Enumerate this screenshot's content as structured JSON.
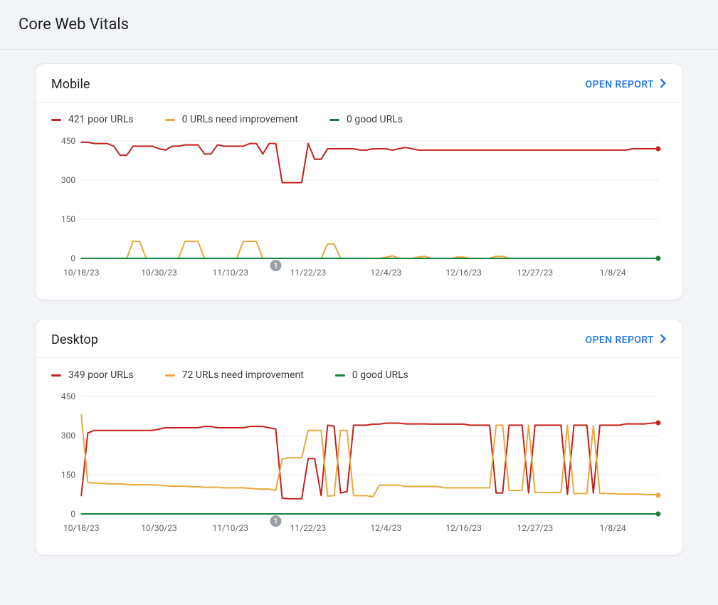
{
  "page": {
    "title": "Core Web Vitals"
  },
  "open_report_label": "OPEN REPORT",
  "colors": {
    "poor": "#c5221f",
    "need": "#e8a93e",
    "good": "#188038",
    "grid": "#e8eaed",
    "axis": "#5f6368"
  },
  "panels": [
    {
      "id": "mobile",
      "title": "Mobile",
      "legend": [
        {
          "key": "poor",
          "label": "421 poor URLs"
        },
        {
          "key": "need",
          "label": "0 URLs need improvement"
        },
        {
          "key": "good",
          "label": "0 good URLs"
        }
      ]
    },
    {
      "id": "desktop",
      "title": "Desktop",
      "legend": [
        {
          "key": "poor",
          "label": "349 poor URLs"
        },
        {
          "key": "need",
          "label": "72 URLs need improvement"
        },
        {
          "key": "good",
          "label": "0 good URLs"
        }
      ]
    }
  ],
  "chart_data": [
    {
      "id": "mobile",
      "type": "line",
      "title": "Mobile",
      "ylim": [
        0,
        450
      ],
      "yticks": [
        0,
        150,
        300,
        450
      ],
      "xticks": [
        "10/18/23",
        "10/30/23",
        "11/10/23",
        "11/22/23",
        "12/4/23",
        "12/16/23",
        "12/27/23",
        "1/8/24"
      ],
      "marker": {
        "x_index": 30,
        "label": "1"
      },
      "x_dates": [
        "10/18/23",
        "10/19/23",
        "10/20/23",
        "10/21/23",
        "10/22/23",
        "10/23/23",
        "10/24/23",
        "10/25/23",
        "10/26/23",
        "10/27/23",
        "10/28/23",
        "10/29/23",
        "10/30/23",
        "10/31/23",
        "11/1/23",
        "11/2/23",
        "11/3/23",
        "11/4/23",
        "11/5/23",
        "11/6/23",
        "11/7/23",
        "11/8/23",
        "11/9/23",
        "11/10/23",
        "11/11/23",
        "11/12/23",
        "11/13/23",
        "11/14/23",
        "11/15/23",
        "11/16/23",
        "11/17/23",
        "11/18/23",
        "11/19/23",
        "11/20/23",
        "11/21/23",
        "11/22/23",
        "11/23/23",
        "11/24/23",
        "11/25/23",
        "11/26/23",
        "11/27/23",
        "11/28/23",
        "11/29/23",
        "11/30/23",
        "12/1/23",
        "12/2/23",
        "12/3/23",
        "12/4/23",
        "12/5/23",
        "12/6/23",
        "12/7/23",
        "12/8/23",
        "12/9/23",
        "12/10/23",
        "12/11/23",
        "12/12/23",
        "12/13/23",
        "12/14/23",
        "12/15/23",
        "12/16/23",
        "12/17/23",
        "12/18/23",
        "12/19/23",
        "12/20/23",
        "12/21/23",
        "12/22/23",
        "12/23/23",
        "12/24/23",
        "12/25/23",
        "12/26/23",
        "12/27/23",
        "12/28/23",
        "12/29/23",
        "12/30/23",
        "12/31/23",
        "1/1/24",
        "1/2/24",
        "1/3/24",
        "1/4/24",
        "1/5/24",
        "1/6/24",
        "1/7/24",
        "1/8/24",
        "1/9/24",
        "1/10/24",
        "1/11/24",
        "1/12/24",
        "1/13/24",
        "1/14/24",
        "1/15/24"
      ],
      "series": [
        {
          "name": "poor",
          "values": [
            445,
            445,
            440,
            440,
            440,
            430,
            395,
            395,
            430,
            430,
            430,
            430,
            420,
            415,
            430,
            430,
            435,
            435,
            435,
            400,
            400,
            435,
            430,
            430,
            430,
            430,
            440,
            440,
            400,
            440,
            440,
            290,
            290,
            290,
            290,
            440,
            380,
            380,
            420,
            420,
            420,
            420,
            420,
            415,
            415,
            420,
            420,
            420,
            415,
            420,
            425,
            420,
            415,
            415,
            415,
            415,
            415,
            415,
            415,
            415,
            415,
            415,
            415,
            415,
            415,
            415,
            415,
            415,
            415,
            415,
            415,
            415,
            415,
            415,
            415,
            415,
            415,
            415,
            415,
            415,
            415,
            415,
            415,
            415,
            415,
            420,
            420,
            420,
            420,
            420
          ]
        },
        {
          "name": "need",
          "values": [
            0,
            0,
            0,
            0,
            0,
            0,
            0,
            0,
            65,
            65,
            0,
            0,
            0,
            0,
            0,
            0,
            65,
            65,
            65,
            0,
            0,
            0,
            0,
            0,
            0,
            65,
            65,
            65,
            0,
            0,
            0,
            0,
            0,
            0,
            0,
            0,
            0,
            0,
            55,
            55,
            0,
            0,
            0,
            0,
            0,
            0,
            0,
            4,
            10,
            0,
            0,
            0,
            5,
            8,
            0,
            0,
            0,
            0,
            5,
            5,
            0,
            0,
            0,
            0,
            8,
            8,
            0,
            0,
            0,
            0,
            0,
            0,
            0,
            0,
            0,
            0,
            0,
            0,
            0,
            0,
            0,
            0,
            0,
            0,
            0,
            0,
            0,
            0,
            0,
            0
          ]
        },
        {
          "name": "good",
          "values": [
            0,
            0,
            0,
            0,
            0,
            0,
            0,
            0,
            0,
            0,
            0,
            0,
            0,
            0,
            0,
            0,
            0,
            0,
            0,
            0,
            0,
            0,
            0,
            0,
            0,
            0,
            0,
            0,
            0,
            0,
            0,
            0,
            0,
            0,
            0,
            0,
            0,
            0,
            0,
            0,
            0,
            0,
            0,
            0,
            0,
            0,
            0,
            0,
            0,
            0,
            0,
            0,
            0,
            0,
            0,
            0,
            0,
            0,
            0,
            0,
            0,
            0,
            0,
            0,
            0,
            0,
            0,
            0,
            0,
            0,
            0,
            0,
            0,
            0,
            0,
            0,
            0,
            0,
            0,
            0,
            0,
            0,
            0,
            0,
            0,
            0,
            0,
            0,
            0,
            0
          ]
        }
      ]
    },
    {
      "id": "desktop",
      "type": "line",
      "title": "Desktop",
      "ylim": [
        0,
        450
      ],
      "yticks": [
        0,
        150,
        300,
        450
      ],
      "xticks": [
        "10/18/23",
        "10/30/23",
        "11/10/23",
        "11/22/23",
        "12/4/23",
        "12/16/23",
        "12/27/23",
        "1/8/24"
      ],
      "marker": {
        "x_index": 30,
        "label": "1"
      },
      "x_dates": [
        "10/18/23",
        "10/19/23",
        "10/20/23",
        "10/21/23",
        "10/22/23",
        "10/23/23",
        "10/24/23",
        "10/25/23",
        "10/26/23",
        "10/27/23",
        "10/28/23",
        "10/29/23",
        "10/30/23",
        "10/31/23",
        "11/1/23",
        "11/2/23",
        "11/3/23",
        "11/4/23",
        "11/5/23",
        "11/6/23",
        "11/7/23",
        "11/8/23",
        "11/9/23",
        "11/10/23",
        "11/11/23",
        "11/12/23",
        "11/13/23",
        "11/14/23",
        "11/15/23",
        "11/16/23",
        "11/17/23",
        "11/18/23",
        "11/19/23",
        "11/20/23",
        "11/21/23",
        "11/22/23",
        "11/23/23",
        "11/24/23",
        "11/25/23",
        "11/26/23",
        "11/27/23",
        "11/28/23",
        "11/29/23",
        "11/30/23",
        "12/1/23",
        "12/2/23",
        "12/3/23",
        "12/4/23",
        "12/5/23",
        "12/6/23",
        "12/7/23",
        "12/8/23",
        "12/9/23",
        "12/10/23",
        "12/11/23",
        "12/12/23",
        "12/13/23",
        "12/14/23",
        "12/15/23",
        "12/16/23",
        "12/17/23",
        "12/18/23",
        "12/19/23",
        "12/20/23",
        "12/21/23",
        "12/22/23",
        "12/23/23",
        "12/24/23",
        "12/25/23",
        "12/26/23",
        "12/27/23",
        "12/28/23",
        "12/29/23",
        "12/30/23",
        "12/31/23",
        "1/1/24",
        "1/2/24",
        "1/3/24",
        "1/4/24",
        "1/5/24",
        "1/6/24",
        "1/7/24",
        "1/8/24",
        "1/9/24",
        "1/10/24",
        "1/11/24",
        "1/12/24",
        "1/13/24",
        "1/14/24",
        "1/15/24"
      ],
      "series": [
        {
          "name": "poor",
          "values": [
            70,
            310,
            320,
            320,
            320,
            320,
            320,
            320,
            320,
            320,
            320,
            320,
            325,
            330,
            330,
            330,
            330,
            330,
            330,
            335,
            335,
            330,
            330,
            330,
            330,
            330,
            335,
            335,
            335,
            330,
            325,
            60,
            58,
            58,
            58,
            212,
            212,
            70,
            340,
            336,
            80,
            86,
            340,
            340,
            340,
            344,
            344,
            348,
            348,
            348,
            345,
            345,
            345,
            345,
            344,
            344,
            344,
            344,
            344,
            344,
            340,
            340,
            340,
            340,
            80,
            80,
            340,
            340,
            340,
            80,
            340,
            340,
            340,
            340,
            340,
            75,
            340,
            340,
            340,
            80,
            340,
            340,
            340,
            340,
            345,
            345,
            345,
            345,
            348,
            349
          ]
        },
        {
          "name": "need",
          "values": [
            380,
            120,
            118,
            118,
            115,
            115,
            115,
            113,
            112,
            112,
            112,
            112,
            110,
            108,
            106,
            106,
            106,
            104,
            104,
            102,
            102,
            102,
            100,
            100,
            100,
            100,
            98,
            96,
            95,
            95,
            90,
            210,
            215,
            215,
            215,
            320,
            320,
            320,
            68,
            70,
            320,
            320,
            70,
            70,
            70,
            66,
            110,
            110,
            110,
            110,
            105,
            105,
            105,
            105,
            105,
            105,
            100,
            100,
            100,
            100,
            100,
            100,
            100,
            100,
            340,
            340,
            90,
            90,
            90,
            340,
            82,
            82,
            82,
            82,
            82,
            340,
            78,
            78,
            78,
            338,
            78,
            78,
            78,
            76,
            76,
            76,
            76,
            74,
            74,
            72
          ]
        },
        {
          "name": "good",
          "values": [
            0,
            0,
            0,
            0,
            0,
            0,
            0,
            0,
            0,
            0,
            0,
            0,
            0,
            0,
            0,
            0,
            0,
            0,
            0,
            0,
            0,
            0,
            0,
            0,
            0,
            0,
            0,
            0,
            0,
            0,
            0,
            0,
            0,
            0,
            0,
            0,
            0,
            0,
            0,
            0,
            0,
            0,
            0,
            0,
            0,
            0,
            0,
            0,
            0,
            0,
            0,
            0,
            0,
            0,
            0,
            0,
            0,
            0,
            0,
            0,
            0,
            0,
            0,
            0,
            0,
            0,
            0,
            0,
            0,
            0,
            0,
            0,
            0,
            0,
            0,
            0,
            0,
            0,
            0,
            0,
            0,
            0,
            0,
            0,
            0,
            0,
            0,
            0,
            0,
            0
          ]
        }
      ]
    }
  ]
}
